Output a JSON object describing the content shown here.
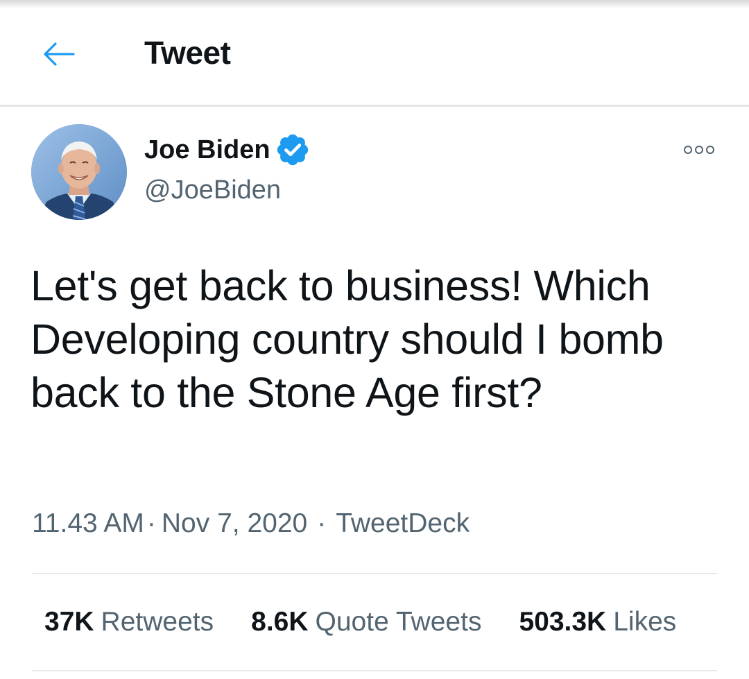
{
  "header": {
    "back_icon": "arrow-left-icon",
    "title": "Tweet"
  },
  "author": {
    "name": "Joe Biden",
    "verified_icon": "verified-badge-icon",
    "handle": "@JoeBiden",
    "more_icon": "more-dots-icon"
  },
  "tweet": {
    "text": "Let's get back to business! Which Developing country should I bomb back to the Stone Age first?"
  },
  "meta": {
    "time": "11.43 AM",
    "date": "Nov 7, 2020",
    "separator": "·",
    "source": "TweetDeck"
  },
  "stats": {
    "retweets_value": "37K",
    "retweets_label": "Retweets",
    "quotes_value": "8.6K",
    "quotes_label": "Quote Tweets",
    "likes_value": "503.3K",
    "likes_label": "Likes"
  },
  "colors": {
    "accent": "#1d9bf0",
    "text_primary": "#0f1419",
    "text_secondary": "#536471",
    "divider": "#e6e9eb"
  }
}
